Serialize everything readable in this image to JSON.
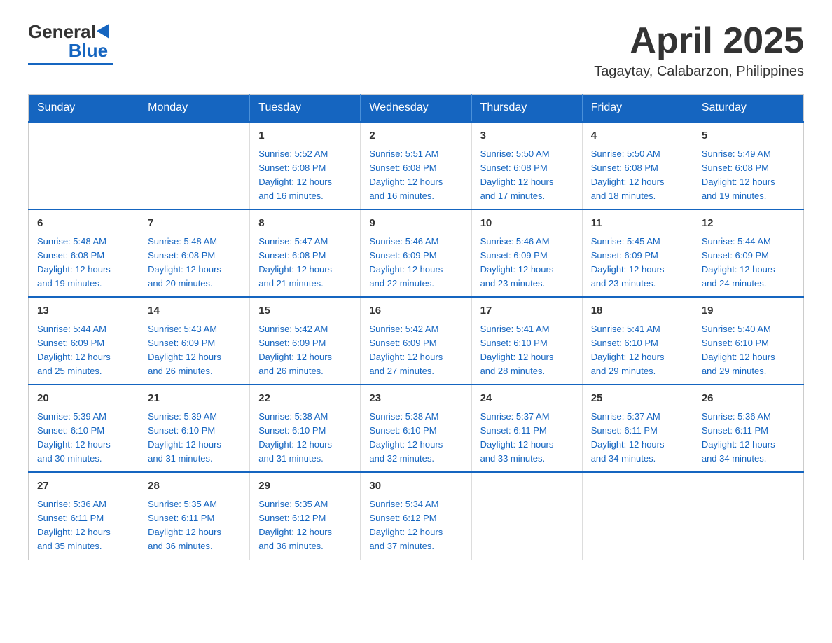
{
  "logo": {
    "general": "General",
    "blue": "Blue"
  },
  "header": {
    "title": "April 2025",
    "location": "Tagaytay, Calabarzon, Philippines"
  },
  "days_of_week": [
    "Sunday",
    "Monday",
    "Tuesday",
    "Wednesday",
    "Thursday",
    "Friday",
    "Saturday"
  ],
  "weeks": [
    [
      {
        "day": "",
        "info": ""
      },
      {
        "day": "",
        "info": ""
      },
      {
        "day": "1",
        "info": "Sunrise: 5:52 AM\nSunset: 6:08 PM\nDaylight: 12 hours\nand 16 minutes."
      },
      {
        "day": "2",
        "info": "Sunrise: 5:51 AM\nSunset: 6:08 PM\nDaylight: 12 hours\nand 16 minutes."
      },
      {
        "day": "3",
        "info": "Sunrise: 5:50 AM\nSunset: 6:08 PM\nDaylight: 12 hours\nand 17 minutes."
      },
      {
        "day": "4",
        "info": "Sunrise: 5:50 AM\nSunset: 6:08 PM\nDaylight: 12 hours\nand 18 minutes."
      },
      {
        "day": "5",
        "info": "Sunrise: 5:49 AM\nSunset: 6:08 PM\nDaylight: 12 hours\nand 19 minutes."
      }
    ],
    [
      {
        "day": "6",
        "info": "Sunrise: 5:48 AM\nSunset: 6:08 PM\nDaylight: 12 hours\nand 19 minutes."
      },
      {
        "day": "7",
        "info": "Sunrise: 5:48 AM\nSunset: 6:08 PM\nDaylight: 12 hours\nand 20 minutes."
      },
      {
        "day": "8",
        "info": "Sunrise: 5:47 AM\nSunset: 6:08 PM\nDaylight: 12 hours\nand 21 minutes."
      },
      {
        "day": "9",
        "info": "Sunrise: 5:46 AM\nSunset: 6:09 PM\nDaylight: 12 hours\nand 22 minutes."
      },
      {
        "day": "10",
        "info": "Sunrise: 5:46 AM\nSunset: 6:09 PM\nDaylight: 12 hours\nand 23 minutes."
      },
      {
        "day": "11",
        "info": "Sunrise: 5:45 AM\nSunset: 6:09 PM\nDaylight: 12 hours\nand 23 minutes."
      },
      {
        "day": "12",
        "info": "Sunrise: 5:44 AM\nSunset: 6:09 PM\nDaylight: 12 hours\nand 24 minutes."
      }
    ],
    [
      {
        "day": "13",
        "info": "Sunrise: 5:44 AM\nSunset: 6:09 PM\nDaylight: 12 hours\nand 25 minutes."
      },
      {
        "day": "14",
        "info": "Sunrise: 5:43 AM\nSunset: 6:09 PM\nDaylight: 12 hours\nand 26 minutes."
      },
      {
        "day": "15",
        "info": "Sunrise: 5:42 AM\nSunset: 6:09 PM\nDaylight: 12 hours\nand 26 minutes."
      },
      {
        "day": "16",
        "info": "Sunrise: 5:42 AM\nSunset: 6:09 PM\nDaylight: 12 hours\nand 27 minutes."
      },
      {
        "day": "17",
        "info": "Sunrise: 5:41 AM\nSunset: 6:10 PM\nDaylight: 12 hours\nand 28 minutes."
      },
      {
        "day": "18",
        "info": "Sunrise: 5:41 AM\nSunset: 6:10 PM\nDaylight: 12 hours\nand 29 minutes."
      },
      {
        "day": "19",
        "info": "Sunrise: 5:40 AM\nSunset: 6:10 PM\nDaylight: 12 hours\nand 29 minutes."
      }
    ],
    [
      {
        "day": "20",
        "info": "Sunrise: 5:39 AM\nSunset: 6:10 PM\nDaylight: 12 hours\nand 30 minutes."
      },
      {
        "day": "21",
        "info": "Sunrise: 5:39 AM\nSunset: 6:10 PM\nDaylight: 12 hours\nand 31 minutes."
      },
      {
        "day": "22",
        "info": "Sunrise: 5:38 AM\nSunset: 6:10 PM\nDaylight: 12 hours\nand 31 minutes."
      },
      {
        "day": "23",
        "info": "Sunrise: 5:38 AM\nSunset: 6:10 PM\nDaylight: 12 hours\nand 32 minutes."
      },
      {
        "day": "24",
        "info": "Sunrise: 5:37 AM\nSunset: 6:11 PM\nDaylight: 12 hours\nand 33 minutes."
      },
      {
        "day": "25",
        "info": "Sunrise: 5:37 AM\nSunset: 6:11 PM\nDaylight: 12 hours\nand 34 minutes."
      },
      {
        "day": "26",
        "info": "Sunrise: 5:36 AM\nSunset: 6:11 PM\nDaylight: 12 hours\nand 34 minutes."
      }
    ],
    [
      {
        "day": "27",
        "info": "Sunrise: 5:36 AM\nSunset: 6:11 PM\nDaylight: 12 hours\nand 35 minutes."
      },
      {
        "day": "28",
        "info": "Sunrise: 5:35 AM\nSunset: 6:11 PM\nDaylight: 12 hours\nand 36 minutes."
      },
      {
        "day": "29",
        "info": "Sunrise: 5:35 AM\nSunset: 6:12 PM\nDaylight: 12 hours\nand 36 minutes."
      },
      {
        "day": "30",
        "info": "Sunrise: 5:34 AM\nSunset: 6:12 PM\nDaylight: 12 hours\nand 37 minutes."
      },
      {
        "day": "",
        "info": ""
      },
      {
        "day": "",
        "info": ""
      },
      {
        "day": "",
        "info": ""
      }
    ]
  ]
}
